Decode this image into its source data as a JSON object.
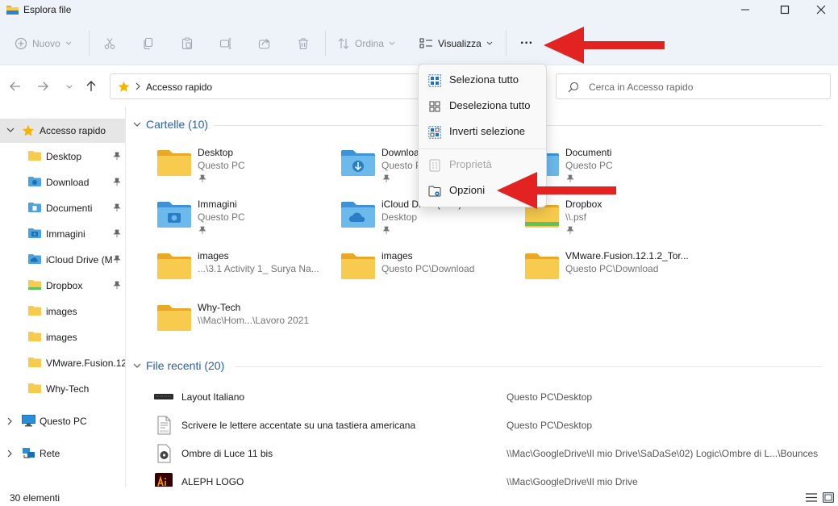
{
  "window": {
    "title": "Esplora file"
  },
  "colors": {
    "accent": "#2b5fa8",
    "folder": "#f7cb4d",
    "arrow": "#e32222"
  },
  "commands": {
    "new_label": "Nuovo",
    "sort_label": "Ordina",
    "view_label": "Visualizza",
    "more_label": "···"
  },
  "address": {
    "path": "Accesso rapido",
    "search_placeholder": "Cerca in Accesso rapido"
  },
  "menu": {
    "items": [
      {
        "label": "Seleziona tutto",
        "icon": "select-all-icon",
        "enabled": true
      },
      {
        "label": "Deseleziona tutto",
        "icon": "select-none-icon",
        "enabled": true
      },
      {
        "label": "Inverti selezione",
        "icon": "invert-selection-icon",
        "enabled": true
      },
      {
        "label": "Proprietà",
        "icon": "properties-icon",
        "enabled": false
      },
      {
        "label": "Opzioni",
        "icon": "options-icon",
        "enabled": true
      }
    ]
  },
  "sidebar": {
    "quick_access": "Accesso rapido",
    "items": [
      {
        "label": "Desktop",
        "icon": "folder-icon",
        "pinned": true
      },
      {
        "label": "Download",
        "icon": "download-folder-icon",
        "pinned": true
      },
      {
        "label": "Documenti",
        "icon": "documents-folder-icon",
        "pinned": true
      },
      {
        "label": "Immagini",
        "icon": "pictures-folder-icon",
        "pinned": true
      },
      {
        "label": "iCloud Drive (M",
        "icon": "icloud-folder-icon",
        "pinned": true
      },
      {
        "label": "Dropbox",
        "icon": "dropbox-folder-icon",
        "pinned": true
      },
      {
        "label": "images",
        "icon": "folder-icon",
        "pinned": false
      },
      {
        "label": "images",
        "icon": "folder-icon",
        "pinned": false
      },
      {
        "label": "VMware.Fusion.12",
        "icon": "folder-icon",
        "pinned": false
      },
      {
        "label": "Why-Tech",
        "icon": "folder-icon",
        "pinned": false
      }
    ],
    "this_pc": "Questo PC",
    "network": "Rete"
  },
  "folders_section": {
    "header": "Cartelle (10)",
    "items": [
      {
        "name": "Desktop",
        "sub": "Questo PC",
        "pinned": true,
        "kind": "plain"
      },
      {
        "name": "Download",
        "sub": "Questo PC",
        "pinned": true,
        "kind": "download"
      },
      {
        "name": "Documenti",
        "sub": "Questo PC",
        "pinned": true,
        "kind": "documents"
      },
      {
        "name": "Immagini",
        "sub": "Questo PC",
        "pinned": true,
        "kind": "pictures"
      },
      {
        "name": "iCloud Drive (Mac)",
        "sub": "Desktop",
        "pinned": true,
        "kind": "icloud"
      },
      {
        "name": "Dropbox",
        "sub": "\\\\.psf",
        "pinned": true,
        "kind": "dropbox"
      },
      {
        "name": "images",
        "sub": "...\\3.1 Activity 1_ Surya Na...",
        "pinned": false,
        "kind": "plain"
      },
      {
        "name": "images",
        "sub": "Questo PC\\Download",
        "pinned": false,
        "kind": "plain"
      },
      {
        "name": "VMware.Fusion.12.1.2_Tor...",
        "sub": "Questo PC\\Download",
        "pinned": false,
        "kind": "plain"
      },
      {
        "name": "Why-Tech",
        "sub": "\\\\Mac\\Hom...\\Lavoro 2021",
        "pinned": false,
        "kind": "plain"
      }
    ]
  },
  "recent_section": {
    "header": "File recenti (20)",
    "items": [
      {
        "name": "Layout Italiano",
        "path": "Questo PC\\Desktop",
        "icon": "keyboard-image-icon"
      },
      {
        "name": "Scrivere le lettere accentate su una tastiera americana",
        "path": "Questo PC\\Desktop",
        "icon": "docx-file-icon"
      },
      {
        "name": "Ombre di Luce 11 bis",
        "path": "\\\\Mac\\GoogleDrive\\Il mio Drive\\SaDaSe\\02) Logic\\Ombre di L...\\Bounces",
        "icon": "audio-file-icon"
      },
      {
        "name": "ALEPH LOGO",
        "path": "\\\\Mac\\GoogleDrive\\Il mio Drive",
        "icon": "illustrator-file-icon"
      }
    ]
  },
  "status": {
    "count": "30 elementi"
  }
}
